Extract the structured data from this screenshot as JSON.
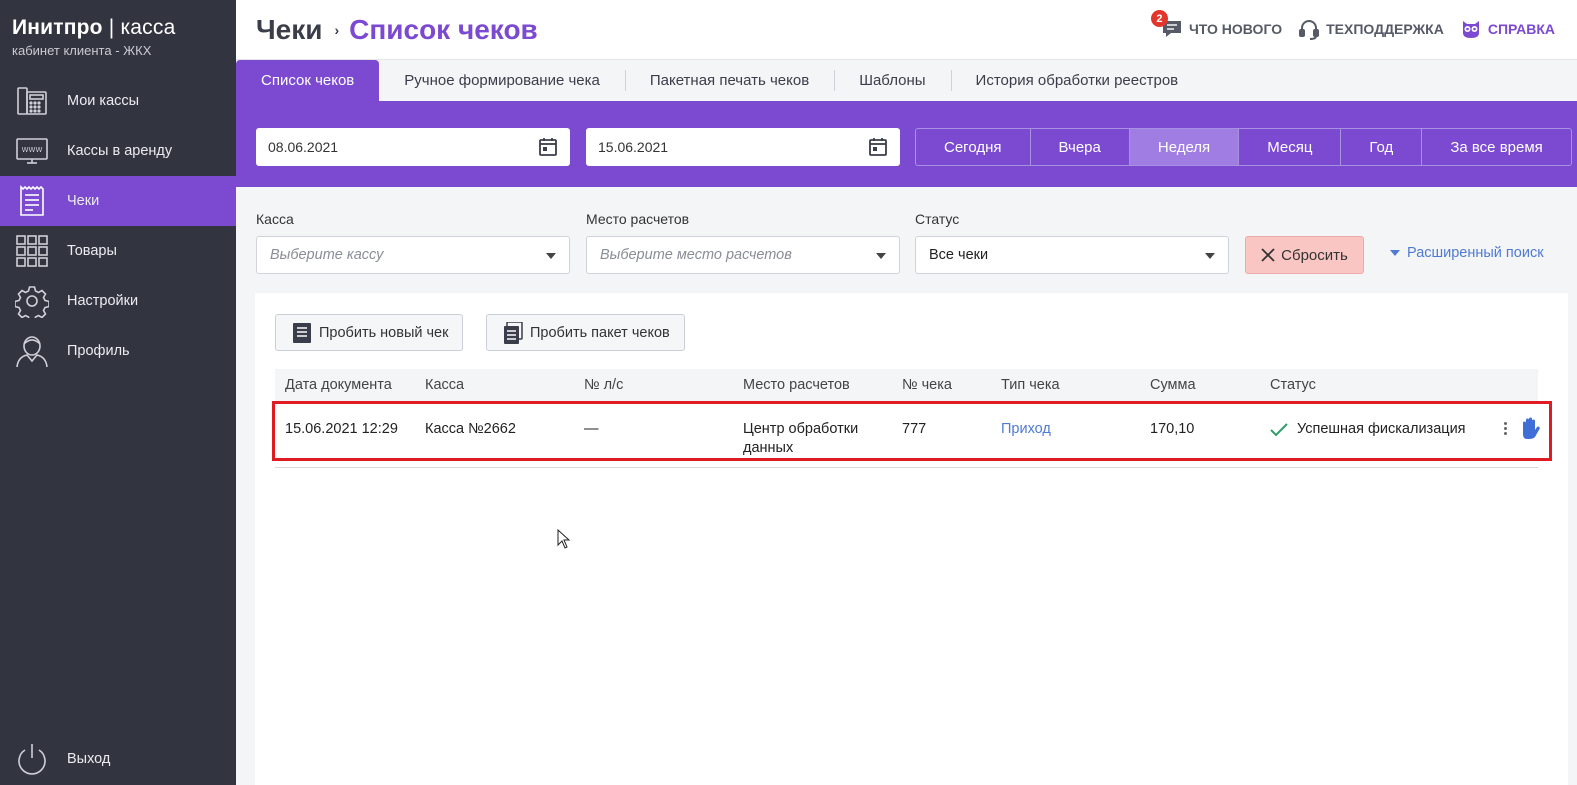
{
  "brand": {
    "name_bold": "Инитпро",
    "separator": " | ",
    "name_light": "касса",
    "subtitle": "кабинет клиента - ЖКХ"
  },
  "sidebar": {
    "items": [
      {
        "label": "Мои кассы",
        "icon": "cash-register-icon"
      },
      {
        "label": "Кассы в аренду",
        "icon": "www-monitor-icon"
      },
      {
        "label": "Чеки",
        "icon": "receipt-icon",
        "active": true
      },
      {
        "label": "Товары",
        "icon": "grid-icon"
      },
      {
        "label": "Настройки",
        "icon": "gear-icon"
      },
      {
        "label": "Профиль",
        "icon": "user-icon"
      }
    ],
    "logout_label": "Выход"
  },
  "header": {
    "breadcrumb_root": "Чеки",
    "breadcrumb_sep": "›",
    "breadcrumb_current": "Список чеков",
    "whats_new_label": "ЧТО НОВОГО",
    "whats_new_badge": "2",
    "support_label": "ТЕХПОДДЕРЖКА",
    "help_label": "СПРАВКА"
  },
  "tabs": [
    {
      "label": "Список чеков",
      "active": true
    },
    {
      "label": "Ручное формирование чека"
    },
    {
      "label": "Пакетная печать чеков"
    },
    {
      "label": "Шаблоны"
    },
    {
      "label": "История обработки реестров"
    }
  ],
  "dates": {
    "from": "08.06.2021",
    "to": "15.06.2021"
  },
  "periods": [
    {
      "label": "Сегодня"
    },
    {
      "label": "Вчера"
    },
    {
      "label": "Неделя",
      "active": true
    },
    {
      "label": "Месяц"
    },
    {
      "label": "Год"
    },
    {
      "label": "За все время"
    }
  ],
  "filters": {
    "kassa_label": "Касса",
    "kassa_placeholder": "Выберите кассу",
    "place_label": "Место расчетов",
    "place_placeholder": "Выберите место расчетов",
    "status_label": "Статус",
    "status_value": "Все чеки",
    "reset_label": "Сбросить",
    "advanced_label": "Расширенный поиск"
  },
  "actions": {
    "new_receipt": "Пробить новый чек",
    "batch_receipts": "Пробить пакет чеков"
  },
  "table": {
    "headers": [
      "Дата документа",
      "Касса",
      "№ л/с",
      "Место расчетов",
      "№ чека",
      "Тип чека",
      "Сумма",
      "Статус"
    ],
    "rows": [
      {
        "date": "15.06.2021 12:29",
        "kassa": "Касса №2662",
        "account": "—",
        "place_line1": "Центр обработки",
        "place_line2": "данных",
        "number": "777",
        "type": "Приход",
        "sum": "170,10",
        "status": "Успешная фискализация"
      }
    ]
  },
  "colors": {
    "accent": "#7b4ad0",
    "sidebar": "#323440",
    "link": "#4f7ad3",
    "highlight": "#e01b22",
    "success": "#2e9e6a"
  }
}
